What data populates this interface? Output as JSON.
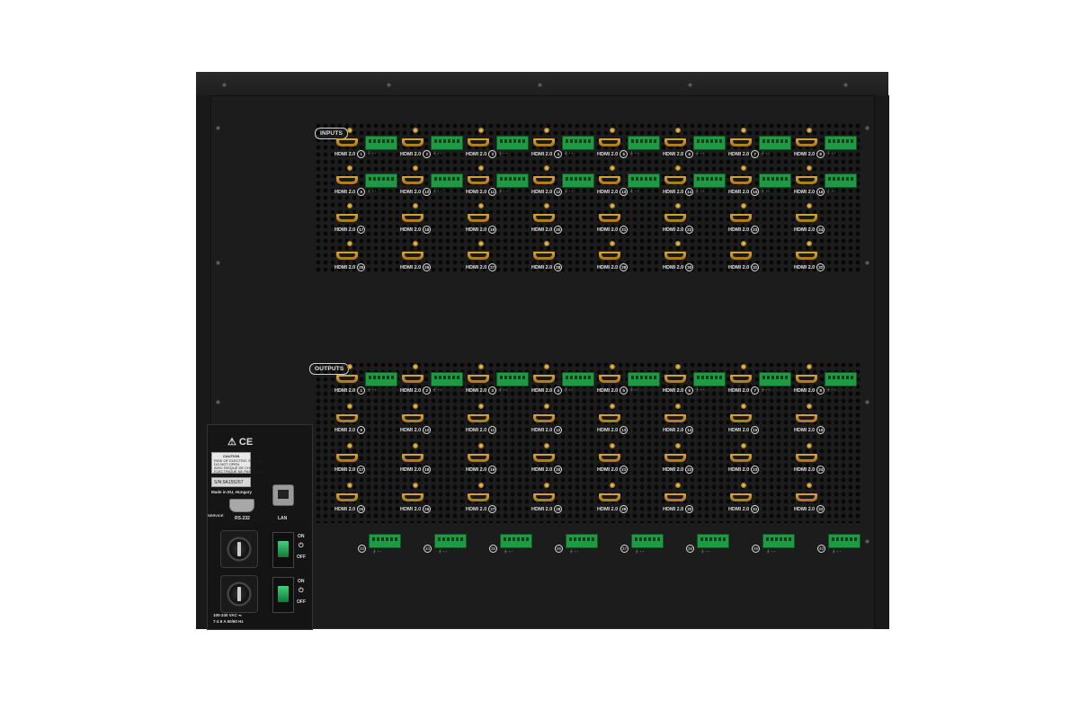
{
  "inputs_label": "INPUTS",
  "outputs_label": "OUTPUTS",
  "hdmi_label": "HDMI 2.0",
  "input_rows": [
    [
      "1",
      "2",
      "3",
      "4",
      "5",
      "6",
      "7",
      "8"
    ],
    [
      "9",
      "10",
      "11",
      "12",
      "13",
      "14",
      "15",
      "16"
    ],
    [
      "17",
      "18",
      "19",
      "20",
      "21",
      "22",
      "23",
      "24"
    ],
    [
      "25",
      "26",
      "27",
      "28",
      "29",
      "30",
      "31",
      "32"
    ]
  ],
  "output_rows": [
    [
      "1",
      "2",
      "3",
      "4",
      "5",
      "6",
      "7",
      "8"
    ],
    [
      "9",
      "10",
      "11",
      "12",
      "13",
      "14",
      "15",
      "16"
    ],
    [
      "17",
      "18",
      "19",
      "20",
      "21",
      "22",
      "23",
      "24"
    ],
    [
      "25",
      "26",
      "27",
      "28",
      "29",
      "30",
      "31",
      "32"
    ]
  ],
  "terminal_row": [
    "33",
    "34",
    "35",
    "36",
    "37",
    "38",
    "39",
    "40"
  ],
  "terminal_label": "⏚ ◦ ◦",
  "service": {
    "ce_mark": "⚠ CE",
    "caution_title": "CAUTION",
    "caution_line1": "RISK OF ELECTRIC SHOCK",
    "caution_line2": "DO NOT OPEN",
    "caution_line3": "AVIS: RISQUE DE CHOC",
    "caution_line4": "ELECTRIQUE NE PAS OUVRIR",
    "serial": "S/N:9A155267",
    "origin": "Made in EU, Hungary",
    "service_label": "SERVICE",
    "rs232_label": "RS-232",
    "lan_label": "LAN"
  },
  "power": {
    "on_label": "ON",
    "off_label": "OFF",
    "power_symbol": "⏻",
    "rating_line1": "100-240 VAC ⏦",
    "rating_line2": "7-2.9 A    50/60 Hz"
  }
}
